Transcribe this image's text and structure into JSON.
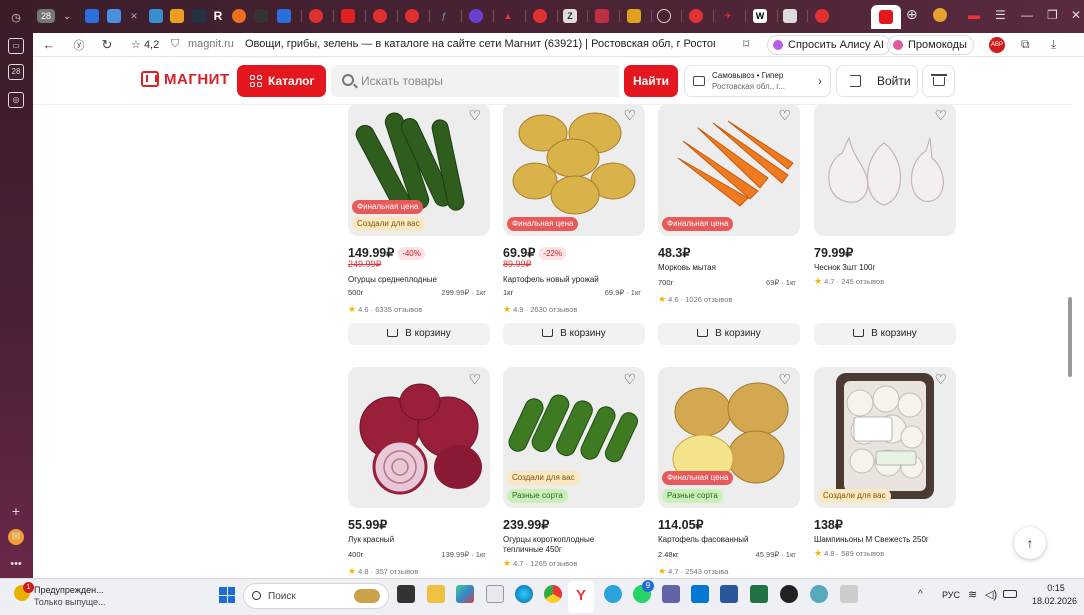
{
  "browser": {
    "tab_count": "28",
    "rating": "4,2",
    "url": "magnit.ru",
    "page_title": "Овощи, грибы, зелень — в каталоге на сайте сети Магнит (63921) | Ростовская обл, г Ростов-на-...",
    "alice_label": "Спросить Алису AI",
    "promo_label": "Промокоды",
    "abp_label": "ABP"
  },
  "header": {
    "logo_text": "МАГНИТ",
    "catalog_label": "Каталог",
    "search_placeholder": "Искать товары",
    "find_label": "Найти",
    "delivery_type": "Самовывоз • Гипер",
    "delivery_address": "Ростовская обл., г...",
    "login_label": "Войти"
  },
  "products": [
    {
      "price": "149.99₽",
      "discount": "-40%",
      "old_price": "249.99₽",
      "name": "Огурцы среднеплодные",
      "weight": "500г",
      "per_kg": "299.99₽ · 1кг",
      "rating": "4.6 · 6335 отзывов",
      "badges": [
        "Финальная цена",
        "Создали для вас"
      ],
      "cart_label": "В корзину"
    },
    {
      "price": "69.9₽",
      "discount": "-22%",
      "old_price": "89.99₽",
      "name": "Картофель новый урожай",
      "weight": "1кг",
      "per_kg": "69.9₽ · 1кг",
      "rating": "4.9 · 2630 отзывов",
      "badges": [
        "Финальная цена"
      ],
      "cart_label": "В корзину"
    },
    {
      "price": "48.3₽",
      "discount": "",
      "old_price": "",
      "name": "Морковь мытая",
      "weight": "700г",
      "per_kg": "69₽ · 1кг",
      "rating": "4.6 · 1026 отзывов",
      "badges": [
        "Финальная цена"
      ],
      "cart_label": "В корзину"
    },
    {
      "price": "79.99₽",
      "discount": "",
      "old_price": "",
      "name": "Чеснок 3шт 100г",
      "weight": "",
      "per_kg": "",
      "rating": "4.7 · 245 отзывов",
      "badges": [],
      "cart_label": "В корзину"
    },
    {
      "price": "55.99₽",
      "discount": "",
      "old_price": "",
      "name": "Лук красный",
      "weight": "400г",
      "per_kg": "139.99₽ · 1кг",
      "rating": "4.8 · 357 отзывов",
      "badges": [],
      "cart_label": "В корзину"
    },
    {
      "price": "239.99₽",
      "discount": "",
      "old_price": "",
      "name": "Огурцы короткоплодные тепличные 450г",
      "weight": "",
      "per_kg": "",
      "rating": "4.7 · 1265 отзывов",
      "badges": [
        "Создали для вас",
        "Разные сорта"
      ],
      "cart_label": "В корзину"
    },
    {
      "price": "114.05₽",
      "discount": "",
      "old_price": "",
      "name": "Картофель фасованный",
      "weight": "2.48кг",
      "per_kg": "45.99₽ · 1кг",
      "rating": "4.7 · 2543 отзыва",
      "badges": [
        "Финальная цена",
        "Разные сорта"
      ],
      "cart_label": "В корзину"
    },
    {
      "price": "138₽",
      "discount": "",
      "old_price": "",
      "name": "Шампиньоны М Свежесть 250г",
      "weight": "",
      "per_kg": "",
      "rating": "4.8 · 589 отзывов",
      "badges": [
        "Создали для вас"
      ],
      "cart_label": "В корзину"
    }
  ],
  "taskbar": {
    "notification_count": "1",
    "notification_title": "Предупрежден...",
    "notification_text": "Только выпуще...",
    "search_label": "Поиск",
    "badge_count": "9",
    "language": "РУС",
    "time": "0:15",
    "date": "18.02.2026"
  },
  "colors": {
    "brand": "#e4161e",
    "final_badge": "#e85a5a",
    "you_badge": "#fbe7c0",
    "variety_badge": "#c9f0b8"
  }
}
